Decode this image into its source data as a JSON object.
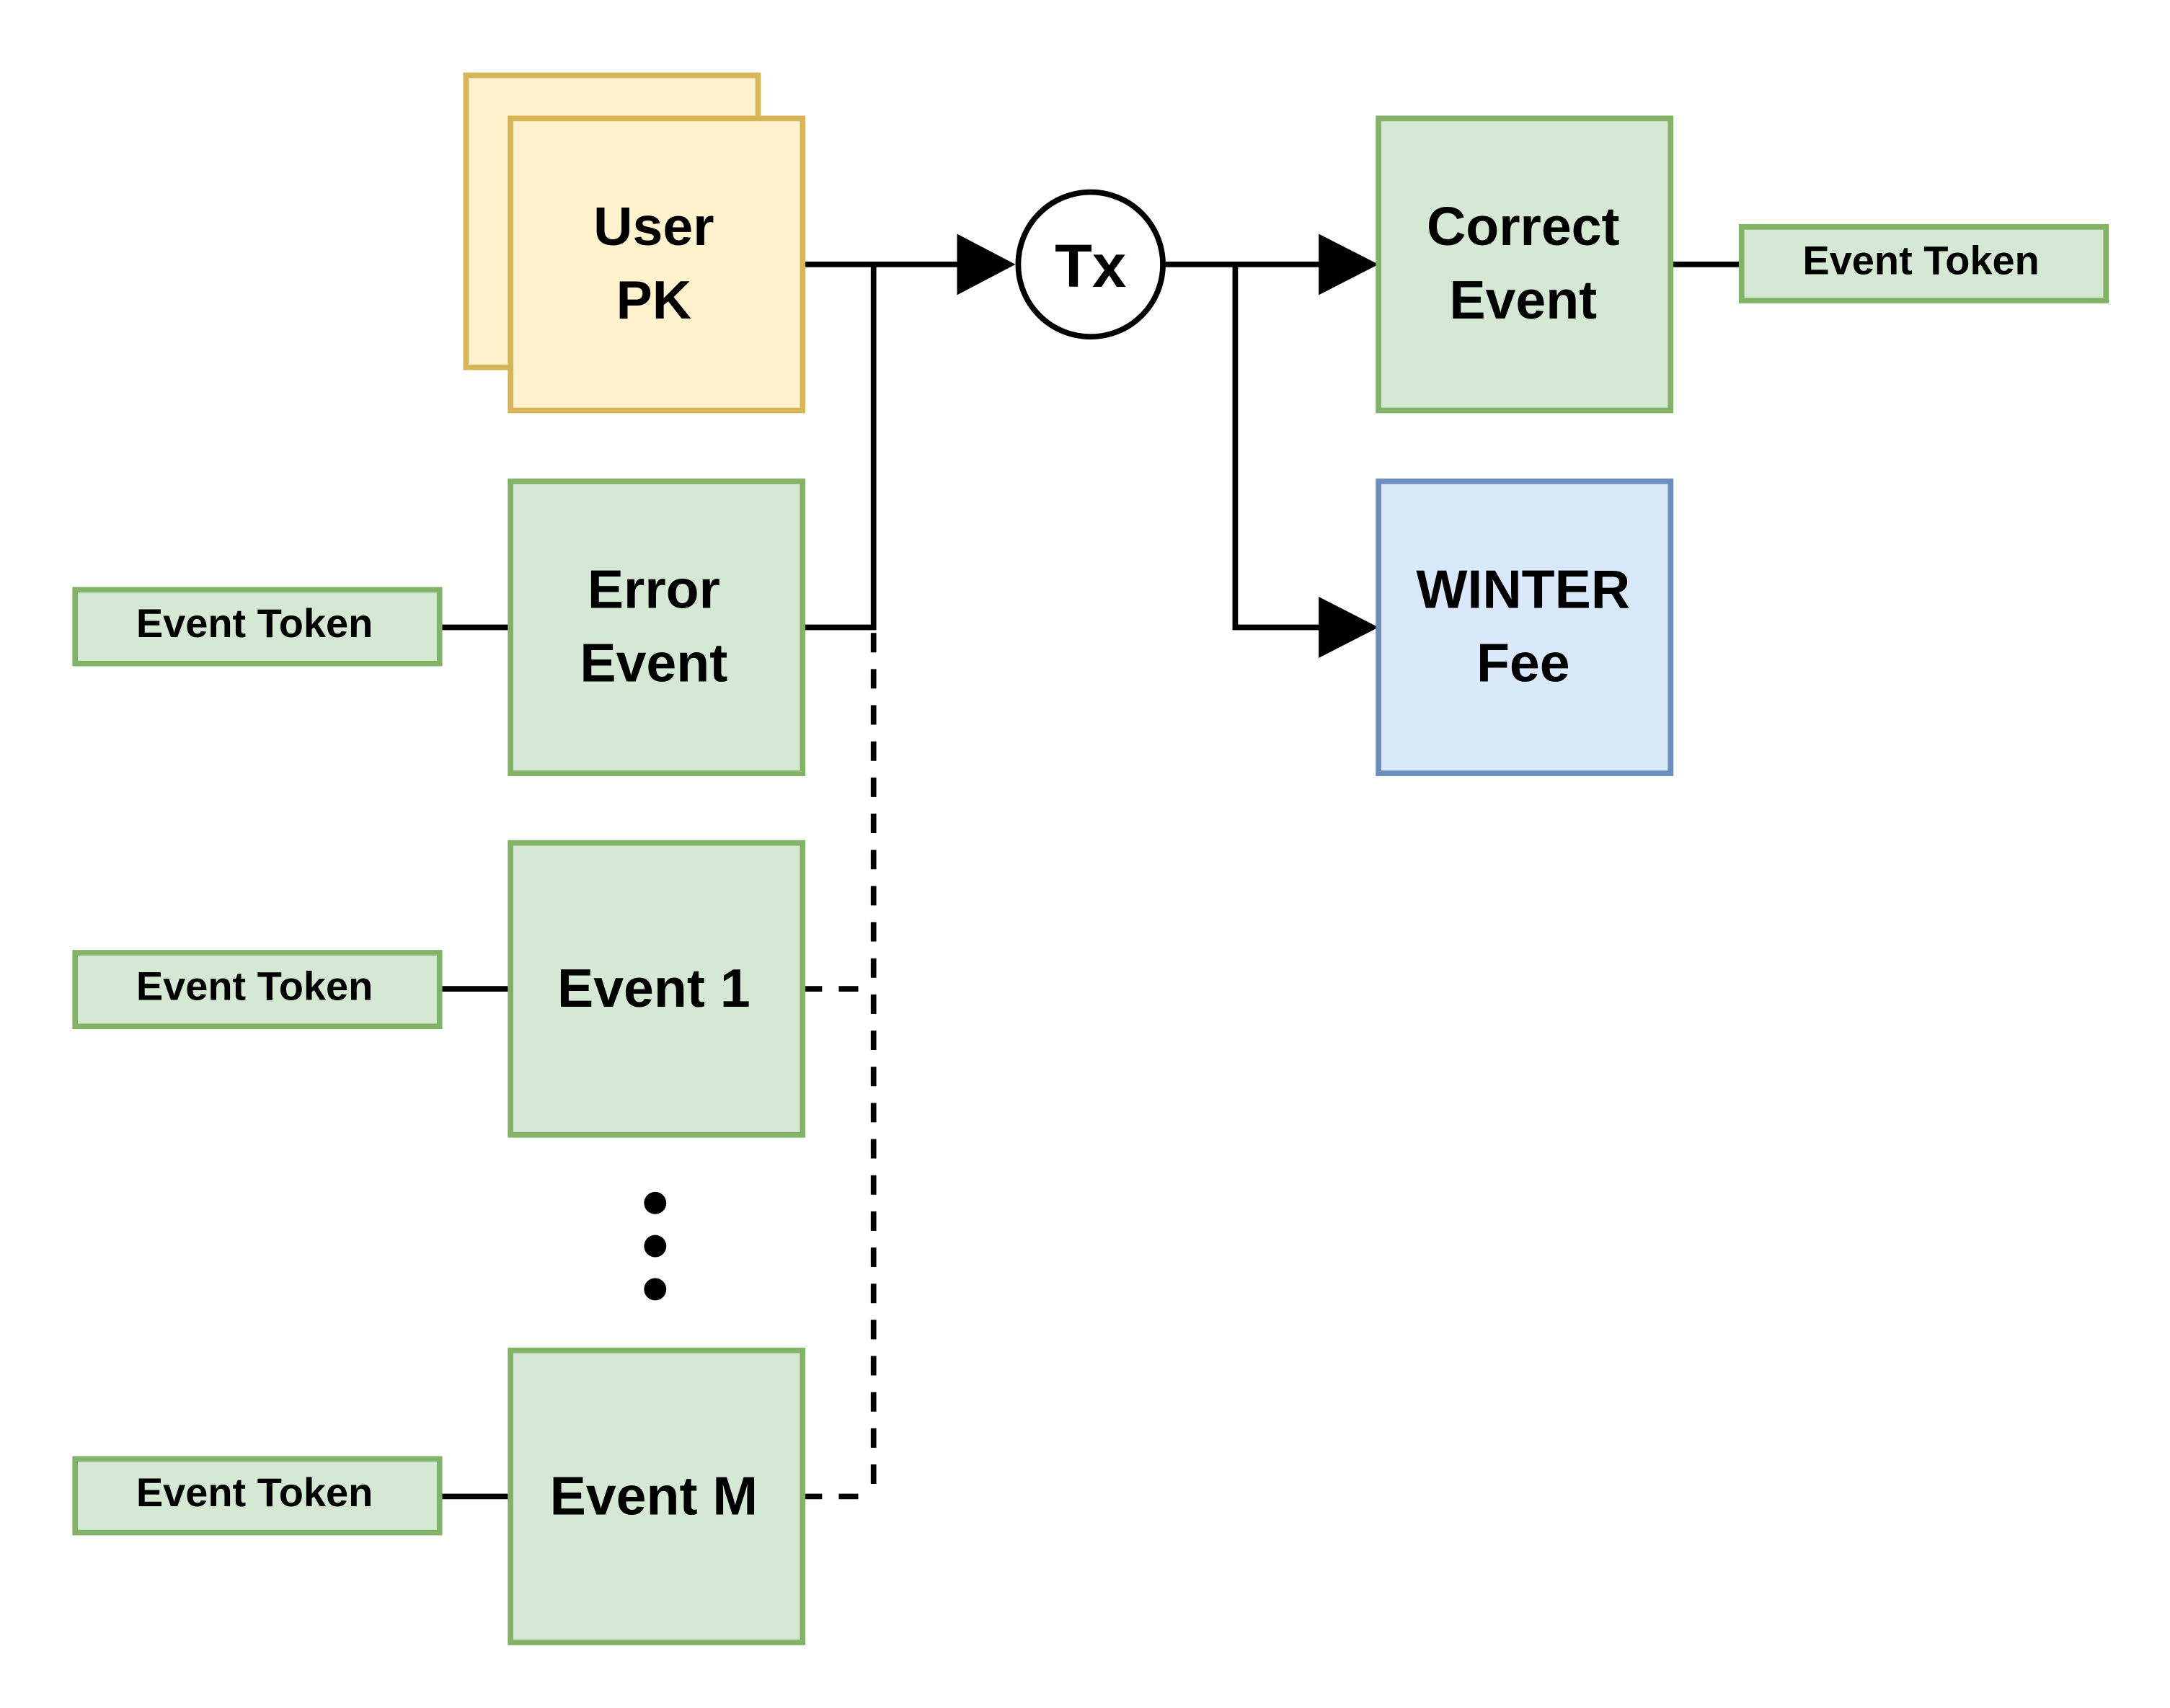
{
  "colors": {
    "user_fill": "#fff2cc",
    "user_stroke": "#d6b656",
    "event_fill": "#d5e8d4",
    "event_stroke": "#82b366",
    "fee_fill": "#dae8fc",
    "fee_stroke": "#6c8ebf"
  },
  "nodes": {
    "user_pk": [
      "User",
      "PK"
    ],
    "error_event": [
      "Error",
      "Event"
    ],
    "event_1": "Event 1",
    "event_m": "Event M",
    "tx": "Tx",
    "correct_event": [
      "Correct",
      "Event"
    ],
    "winter_fee": [
      "WINTER",
      "Fee"
    ]
  },
  "tokens": {
    "error": "Event Token",
    "event_1": "Event Token",
    "event_m": "Event Token",
    "correct": "Event Token"
  },
  "ellipsis_icon": "vertical-dots"
}
